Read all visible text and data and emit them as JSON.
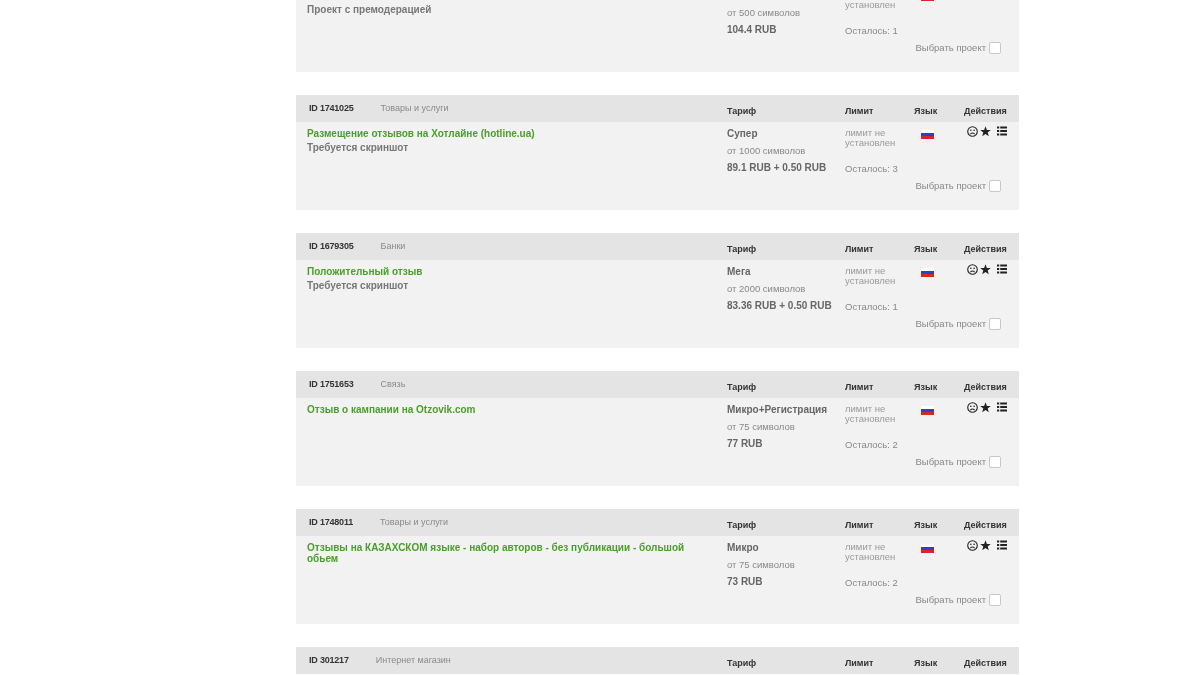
{
  "projects": [
    {
      "body": {
        "note": "Проект с премодерацией",
        "tariff": {
          "chars": "от 500 символов",
          "price": "104.4 RUB"
        },
        "limit": "установлен",
        "remaining": "Осталось: 1",
        "select": {
          "label": "Выбрать проект",
          "checked": false
        }
      }
    },
    {
      "header": {
        "id": "ID 1741025",
        "category": "Товары и услуги",
        "columns": [
          "Тариф",
          "Лимит",
          "Язык",
          "Действия"
        ]
      },
      "body": {
        "title": "Размещение отзывов на Хотлайне (hotline.ua)",
        "note": "Требуется скриншот",
        "tariff": {
          "name": "Супер",
          "chars": "от 1000 символов",
          "price": "89.1 RUB + 0.50 RUB"
        },
        "limit": "лимит не установлен",
        "remaining": "Осталось: 3",
        "select": {
          "label": "Выбрать проект",
          "checked": false
        }
      }
    },
    {
      "header": {
        "id": "ID 1679305",
        "category": "Банки",
        "columns": [
          "Тариф",
          "Лимит",
          "Язык",
          "Действия"
        ]
      },
      "body": {
        "title": "Положительный отзыв",
        "note": "Требуется скриншот",
        "tariff": {
          "name": "Мега",
          "chars": "от 2000 символов",
          "price": "83.36 RUB + 0.50 RUB"
        },
        "limit": "лимит не установлен",
        "remaining": "Осталось: 1",
        "select": {
          "label": "Выбрать проект",
          "checked": false
        }
      }
    },
    {
      "header": {
        "id": "ID 1751653",
        "category": "Связь",
        "columns": [
          "Тариф",
          "Лимит",
          "Язык",
          "Действия"
        ]
      },
      "body": {
        "title": "Отзыв о кампании на Otzovik.com",
        "tariff": {
          "name": "Микро+Регистрация",
          "chars": "от 75 символов",
          "price": "77 RUB"
        },
        "limit": "лимит не установлен",
        "remaining": "Осталось: 2",
        "select": {
          "label": "Выбрать проект",
          "checked": false
        }
      }
    },
    {
      "header": {
        "id": "ID 1748011",
        "category": "Товары и услуги",
        "columns": [
          "Тариф",
          "Лимит",
          "Язык",
          "Действия"
        ]
      },
      "body": {
        "title": "Отзывы на КАЗАХСКОМ языке - набор авторов - без публикации - большой обьем",
        "tariff": {
          "name": "Микро",
          "chars": "от 75 символов",
          "price": "73 RUB"
        },
        "limit": "лимит не установлен",
        "remaining": "Осталось: 2",
        "select": {
          "label": "Выбрать проект",
          "checked": false
        }
      }
    },
    {
      "header": {
        "id": "ID 301217",
        "category": "Интернет магазин",
        "columns": [
          "Тариф",
          "Лимит",
          "Язык",
          "Действия"
        ]
      }
    }
  ]
}
